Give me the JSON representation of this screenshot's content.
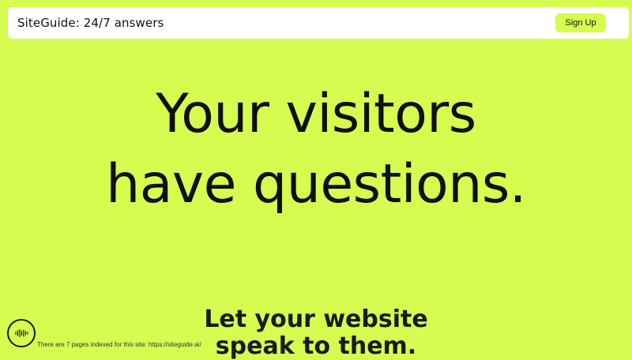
{
  "header": {
    "title": "SiteGuide: 24/7 answers",
    "signup_label": "Sign Up"
  },
  "hero": {
    "line1": "Your visitors",
    "line2": "have questions."
  },
  "subheading": {
    "line1": "Let your website",
    "line2": "speak to them."
  },
  "widget": {
    "icon": "audio-waveform-chat-icon"
  },
  "footer": {
    "note": "There are 7 pages indexed for this site: https://siteguide.ai/"
  },
  "colors": {
    "accent": "#d5fc4f",
    "text": "#111111",
    "header_bg": "#ffffff"
  }
}
